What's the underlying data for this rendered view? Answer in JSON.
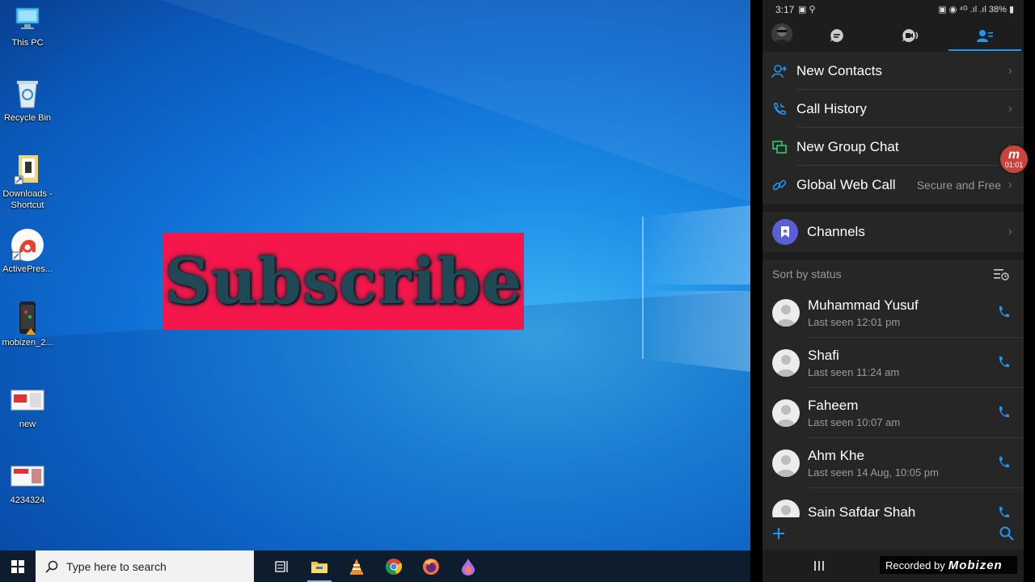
{
  "desktop": {
    "icons": [
      {
        "label": "This PC",
        "icon": "this-pc-icon"
      },
      {
        "label": "Recycle Bin",
        "icon": "recycle-bin-icon"
      },
      {
        "label": "Downloads - Shortcut",
        "icon": "downloads-shortcut-icon"
      },
      {
        "label": "ActivePres...",
        "icon": "activepresenter-icon"
      },
      {
        "label": "mobizen_2...",
        "icon": "mobizen-file-icon"
      },
      {
        "label": "new",
        "icon": "image-file-icon"
      },
      {
        "label": "4234324",
        "icon": "image-file-icon"
      }
    ],
    "banner_text": "Subscribe"
  },
  "taskbar": {
    "search_placeholder": "Type here to search",
    "apps": [
      "task-view-icon",
      "file-explorer-icon",
      "vlc-icon",
      "chrome-icon",
      "firefox-icon",
      "firefox-nightly-icon"
    ]
  },
  "phone": {
    "status": {
      "time": "3:17",
      "battery": "38%"
    },
    "menu": [
      {
        "label": "New Contacts",
        "icon": "add-contact-icon",
        "sub": ""
      },
      {
        "label": "Call History",
        "icon": "call-history-icon",
        "sub": ""
      },
      {
        "label": "New Group Chat",
        "icon": "group-chat-icon",
        "sub": ""
      },
      {
        "label": "Global Web Call",
        "icon": "link-icon",
        "sub": "Secure and Free"
      }
    ],
    "channels_label": "Channels",
    "sort_label": "Sort by status",
    "contacts": [
      {
        "name": "Muhammad Yusuf",
        "seen": "Last seen 12:01 pm"
      },
      {
        "name": "Shafi",
        "seen": "Last seen 11:24 am"
      },
      {
        "name": "Faheem",
        "seen": "Last seen 10:07 am"
      },
      {
        "name": "Ahm Khe",
        "seen": "Last seen 14 Aug, 10:05 pm"
      },
      {
        "name": "Sain Safdar Shah",
        "seen": ""
      }
    ],
    "recorder_time": "01:01"
  },
  "watermark": {
    "prefix": "Recorded by",
    "brand": "Mobizen"
  },
  "colors": {
    "accent": "#2196f3",
    "banner": "#f5174b",
    "phone_bg": "#262626"
  }
}
